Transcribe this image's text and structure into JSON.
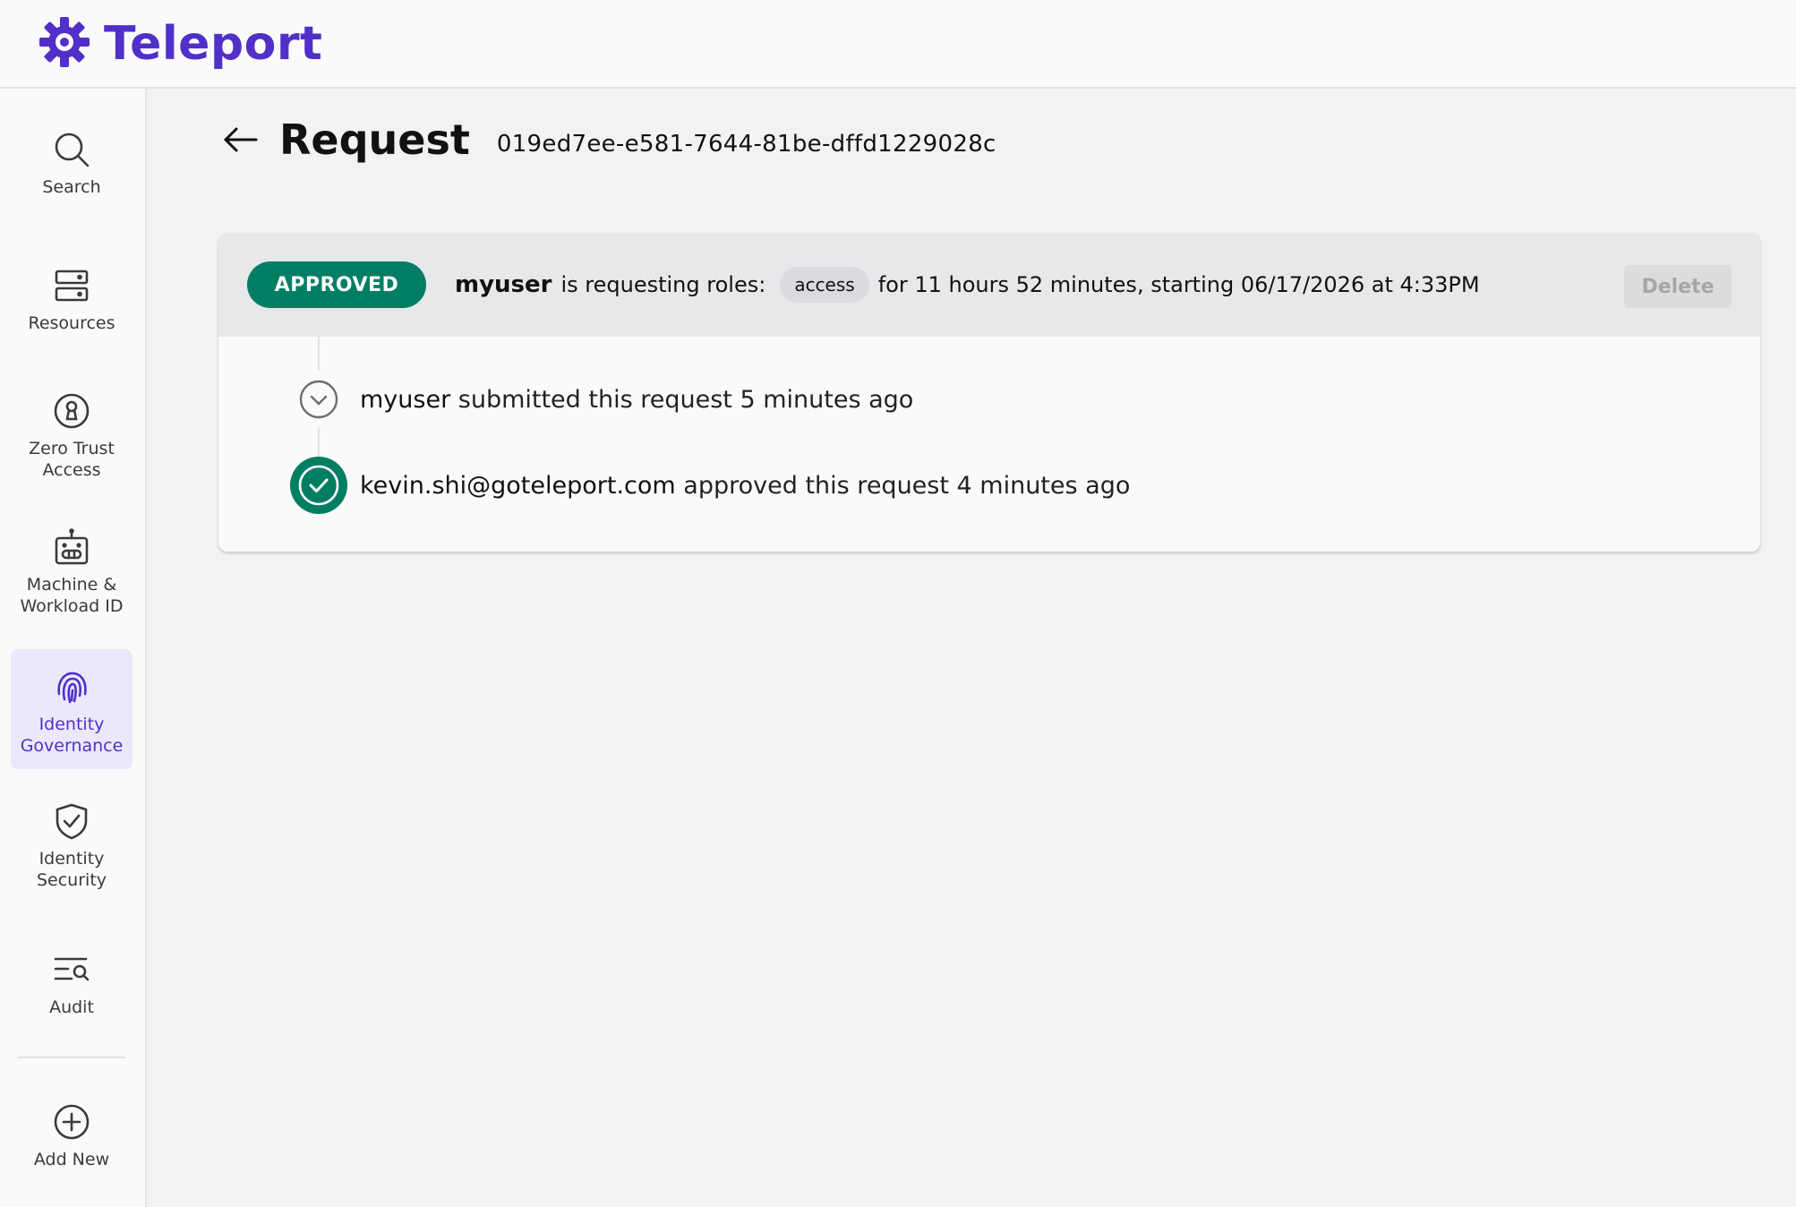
{
  "app": {
    "name": "Teleport",
    "brand_color": "#512fc9"
  },
  "sidebar": {
    "items": [
      {
        "label": "Search",
        "icon": "search-icon"
      },
      {
        "label": "Resources",
        "icon": "server-icon"
      },
      {
        "label": "Zero Trust Access",
        "icon": "keyhole-icon"
      },
      {
        "label": "Machine & Workload ID",
        "icon": "robot-icon"
      },
      {
        "label": "Identity Governance",
        "icon": "fingerprint-icon",
        "active": true
      },
      {
        "label": "Identity Security",
        "icon": "shield-check-icon"
      },
      {
        "label": "Audit",
        "icon": "list-search-icon"
      },
      {
        "label": "Add New",
        "icon": "plus-circle-icon"
      }
    ]
  },
  "page": {
    "title": "Request",
    "request_id": "019ed7ee-e581-7644-81be-dffd1229028c"
  },
  "request": {
    "status": "APPROVED",
    "status_color": "#007e64",
    "user": "myuser",
    "requesting_text": "is requesting roles:",
    "role": "access",
    "duration_text": "for 11 hours 52 minutes, starting 06/17/2026 at 4:33PM",
    "delete_label": "Delete"
  },
  "timeline": [
    {
      "actor": "myuser",
      "text": "submitted this request 5 minutes ago",
      "icon": "chevron-down-circle-icon"
    },
    {
      "actor": "kevin.shi@goteleport.com",
      "text": "approved this request 4 minutes ago",
      "icon": "check-circle-icon"
    }
  ]
}
